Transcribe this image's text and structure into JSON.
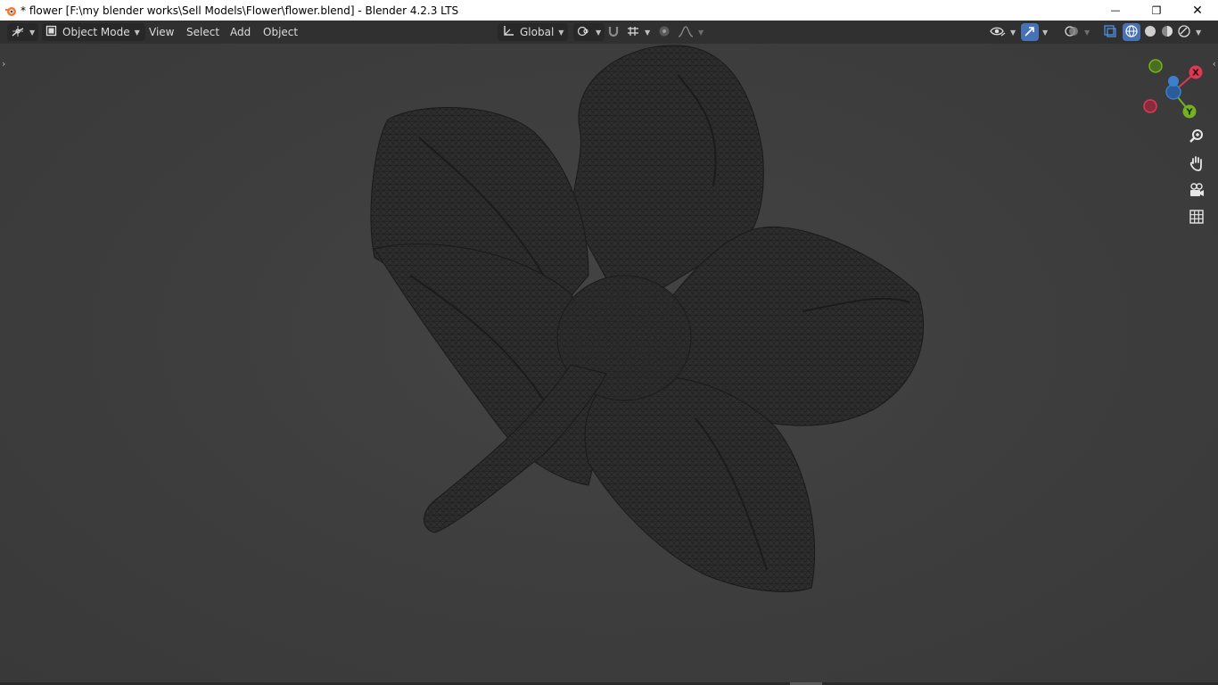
{
  "window": {
    "title": "* flower [F:\\my blender works\\Sell Models\\Flower\\flower.blend] - Blender 4.2.3 LTS",
    "controls": {
      "minimize": "—",
      "restore": "❐",
      "close": "✕"
    }
  },
  "header": {
    "editor_type_icon": "editor-type-icon",
    "mode": "Object Mode",
    "menus": [
      "View",
      "Select",
      "Add",
      "Object"
    ],
    "transform_orientation": "Global"
  },
  "gizmo": {
    "x_label": "X",
    "y_label": "Y",
    "z_label": ""
  },
  "colors": {
    "x_axis": "#dd3954",
    "y_axis": "#73b120",
    "z_axis": "#3a80ce",
    "accent": "#4772b3"
  },
  "viewport": {
    "object": "flower mesh (wireframe overlay)"
  }
}
